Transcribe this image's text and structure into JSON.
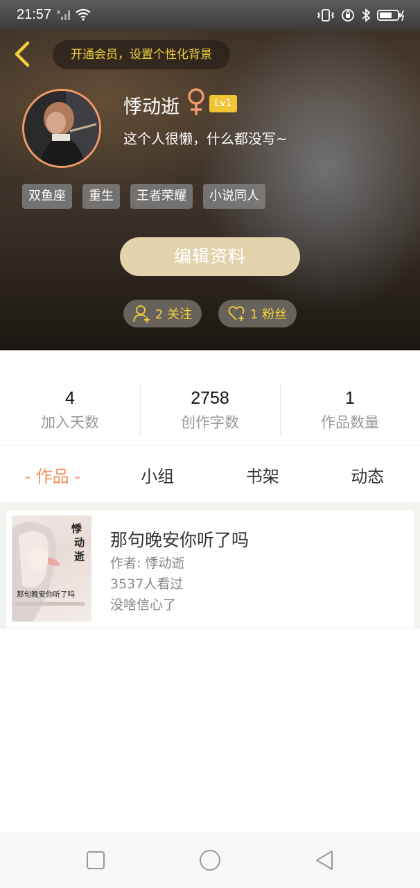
{
  "status_bar": {
    "time": "21:57",
    "icons": [
      "signal-off-icon",
      "wifi-icon",
      "vibrate-icon",
      "alarm-icon",
      "bluetooth-icon",
      "battery-charging-icon"
    ]
  },
  "header": {
    "member_prompt": "开通会员，设置个性化背景"
  },
  "profile": {
    "username": "悸动逝",
    "gender_symbol": "♀",
    "level": "Lv1",
    "bio": "这个人很懒，什么都没写~",
    "tags": [
      "双鱼座",
      "重生",
      "王者荣耀",
      "小说同人"
    ],
    "edit_button": "编辑资料",
    "following": "2 关注",
    "followers": "1 粉丝"
  },
  "stats": [
    {
      "value": "4",
      "label": "加入天数"
    },
    {
      "value": "2758",
      "label": "创作字数"
    },
    {
      "value": "1",
      "label": "作品数量"
    }
  ],
  "tabs": [
    {
      "label": "- 作品 -",
      "active": true
    },
    {
      "label": "小组",
      "active": false
    },
    {
      "label": "书架",
      "active": false
    },
    {
      "label": "动态",
      "active": false
    }
  ],
  "works": [
    {
      "title": "那句晚安你听了吗",
      "author": "作者: 悸动逝",
      "views": "3537人看过",
      "description": "没啥信心了",
      "cover_text_vertical": "悸动逝",
      "cover_title": "那句晚安你听了吗"
    }
  ],
  "colors": {
    "accent": "#f0925a",
    "member_text": "#f3d23a",
    "level_badge": "#f1c437",
    "edit_button": "#e2d3ac",
    "avatar_ring": "#f09a6a"
  }
}
